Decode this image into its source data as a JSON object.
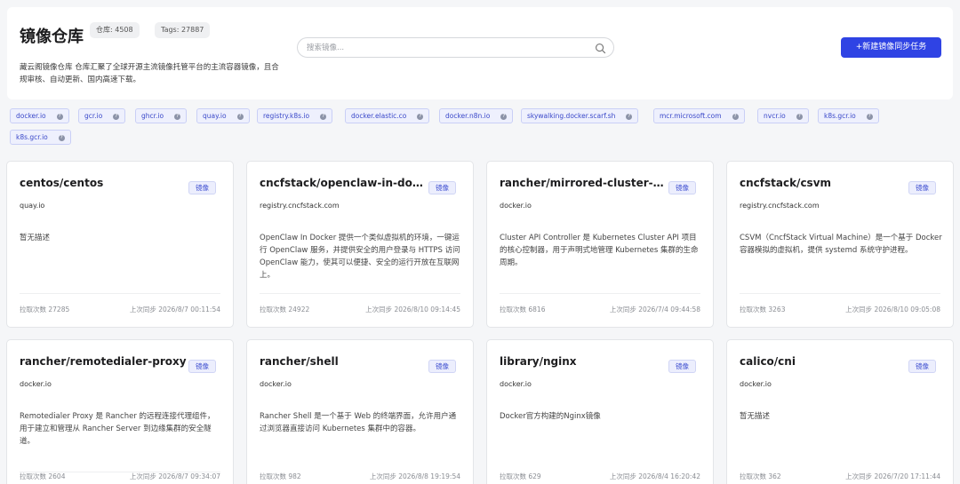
{
  "header": {
    "title": "镜像仓库",
    "repo_count_label": "仓库: 4508",
    "tags_count_label": "Tags: 27887",
    "description": "藏云阁镜像仓库 仓库汇聚了全球开源主流镜像托管平台的主流容器镜像，且合规审核、自动更新、国内高速下载。",
    "search": {
      "placeholder": "搜索镜像...",
      "value": "",
      "icon": "search-icon"
    },
    "sync_button_label": "+新建镜像同步任务"
  },
  "registries": [
    "docker.io",
    "gcr.io",
    "ghcr.io",
    "quay.io",
    "registry.k8s.io",
    "docker.elastic.co",
    "docker.n8n.io",
    "skywalking.docker.scarf.sh",
    "mcr.microsoft.com",
    "nvcr.io",
    "k8s.gcr.io",
    "k8s.gcr.io"
  ],
  "cards": [
    {
      "title": "centos/centos",
      "badge": "镜像",
      "registry": "quay.io",
      "description": "暂无描述",
      "pulls": "拉取次数 27285",
      "synced": "上次同步 2026/8/7 00:11:54"
    },
    {
      "title": "cncfstack/openclaw-in-doc...",
      "badge": "镜像",
      "registry": "registry.cncfstack.com",
      "description": "OpenClaw In Docker 提供一个类似虚拟机的环境，一键运行 OpenClaw 服务，并提供安全的用户登录与 HTTPS 访问 OpenClaw 能力，使其可以便捷、安全的运行开放在互联网上。",
      "pulls": "拉取次数 24922",
      "synced": "上次同步 2026/8/10 09:14:45"
    },
    {
      "title": "rancher/mirrored-cluster-a...",
      "badge": "镜像",
      "registry": "docker.io",
      "description": "Cluster API Controller 是 Kubernetes Cluster API 项目的核心控制器，用于声明式地管理 Kubernetes 集群的生命周期。",
      "pulls": "拉取次数 6816",
      "synced": "上次同步 2026/7/4 09:44:58"
    },
    {
      "title": "cncfstack/csvm",
      "badge": "镜像",
      "registry": "registry.cncfstack.com",
      "description": "CSVM（CncfStack Virtual Machine）是一个基于 Docker 容器模拟的虚拟机，提供 systemd 系统守护进程。",
      "pulls": "拉取次数 3263",
      "synced": "上次同步 2026/8/10 09:05:08"
    },
    {
      "title": "rancher/remotedialer-proxy",
      "badge": "镜像",
      "registry": "docker.io",
      "description": "Remotedialer Proxy 是 Rancher 的远程连接代理组件，用于建立和管理从 Rancher Server 到边缘集群的安全隧道。",
      "pulls": "拉取次数 2604",
      "synced": "上次同步 2026/8/7 09:34:07"
    },
    {
      "title": "rancher/shell",
      "badge": "镜像",
      "registry": "docker.io",
      "description": "Rancher Shell 是一个基于 Web 的终端界面，允许用户通过浏览器直接访问 Kubernetes 集群中的容器。",
      "pulls": "拉取次数 982",
      "synced": "上次同步 2026/8/8 19:19:54"
    },
    {
      "title": "library/nginx",
      "badge": "镜像",
      "registry": "docker.io",
      "description": "Docker官方构建的Nginx镜像",
      "pulls": "拉取次数 629",
      "synced": "上次同步 2026/8/4 16:20:42"
    },
    {
      "title": "calico/cni",
      "badge": "镜像",
      "registry": "docker.io",
      "description": "暂无描述",
      "pulls": "拉取次数 362",
      "synced": "上次同步 2026/7/20 17:11:44"
    }
  ]
}
